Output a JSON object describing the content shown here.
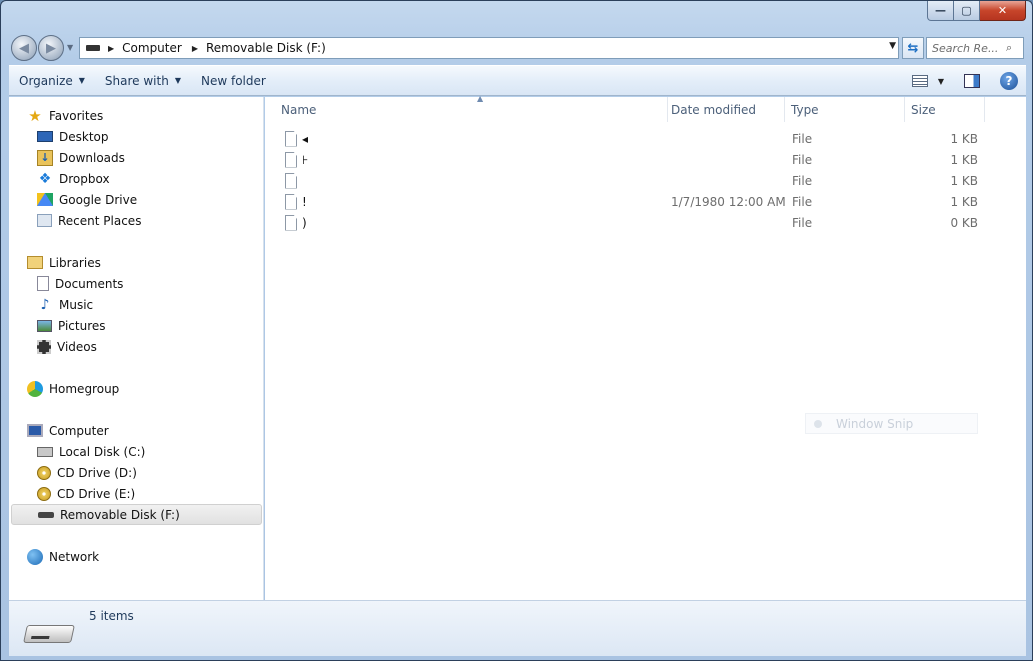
{
  "window": {
    "minimize_label": "—",
    "maximize_label": "▢",
    "close_label": "✕"
  },
  "nav": {
    "back_label": "◀",
    "forward_label": "▶",
    "breadcrumbs": [
      "Computer",
      "Removable Disk (F:)"
    ],
    "search_placeholder": "Search Re..."
  },
  "toolbar": {
    "organize_label": "Organize",
    "share_label": "Share with",
    "new_folder_label": "New folder",
    "help_label": "?"
  },
  "sidebar": {
    "favorites": {
      "label": "Favorites",
      "items": [
        "Desktop",
        "Downloads",
        "Dropbox",
        "Google Drive",
        "Recent Places"
      ]
    },
    "libraries": {
      "label": "Libraries",
      "items": [
        "Documents",
        "Music",
        "Pictures",
        "Videos"
      ]
    },
    "homegroup": {
      "label": "Homegroup"
    },
    "computer": {
      "label": "Computer",
      "items": [
        "Local Disk (C:)",
        "CD Drive (D:)",
        "CD Drive (E:)",
        "Removable Disk (F:)"
      ],
      "selected": "Removable Disk (F:)"
    },
    "network": {
      "label": "Network"
    }
  },
  "file_list": {
    "columns": [
      "Name",
      "Date modified",
      "Type",
      "Size"
    ],
    "rows": [
      {
        "name": "◂",
        "date": "",
        "type": "File",
        "size": "1 KB"
      },
      {
        "name": "⊦",
        "date": "",
        "type": "File",
        "size": "1 KB"
      },
      {
        "name": "",
        "date": "",
        "type": "File",
        "size": "1 KB"
      },
      {
        "name": "!",
        "date": "1/7/1980 12:00 AM",
        "type": "File",
        "size": "1 KB"
      },
      {
        "name": ")",
        "date": "",
        "type": "File",
        "size": "0 KB"
      }
    ]
  },
  "snip_ghost": {
    "label": "Window Snip"
  },
  "details": {
    "item_count": "5 items"
  }
}
